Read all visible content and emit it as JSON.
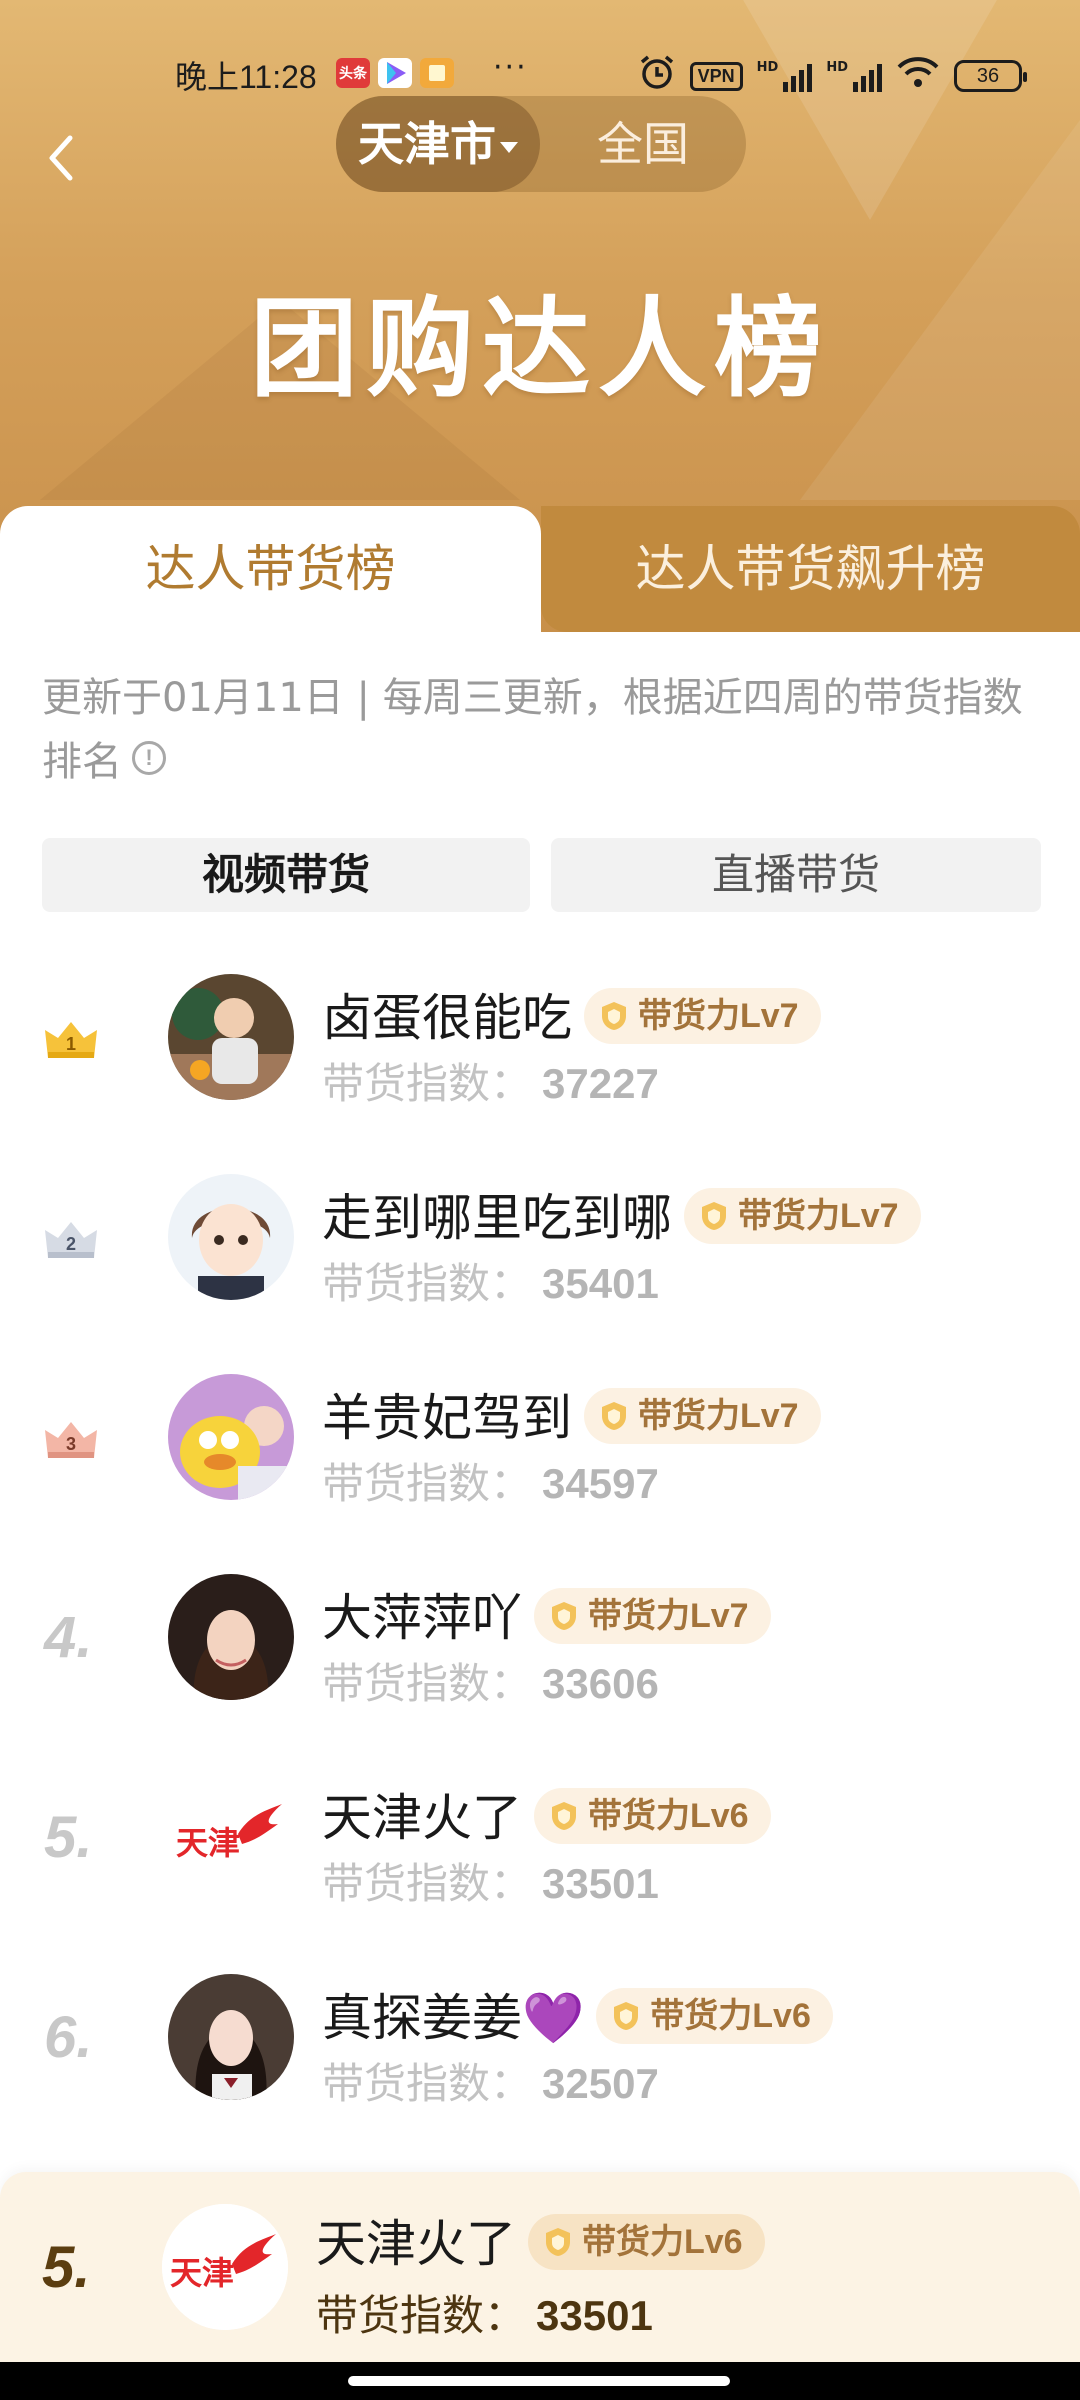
{
  "status_bar": {
    "time": "晚上11:28",
    "app_icons": [
      {
        "name": "toutiao-icon",
        "text": "头条",
        "color": "#e03a3a"
      },
      {
        "name": "video-app-icon",
        "text": "",
        "color": "#8a5cf6"
      },
      {
        "name": "reader-app-icon",
        "text": "",
        "color": "#f2a93b"
      }
    ],
    "more": "···",
    "vpn": "VPN",
    "hd1": "HD",
    "hd2": "HD",
    "battery": "36"
  },
  "nav": {
    "city_selected": "天津市",
    "city_other": "全国"
  },
  "title": "团购达人榜",
  "tabs": {
    "active": "达人带货榜",
    "inactive": "达人带货飙升榜"
  },
  "notice": "更新于01月11日 | 每周三更新，根据近四周的带货指数排名",
  "segments": {
    "video": "视频带货",
    "live": "直播带货"
  },
  "score_label": "带货指数：",
  "items": [
    {
      "rank": "1",
      "name": "卤蛋很能吃",
      "level": "带货力Lv7",
      "score": "37227"
    },
    {
      "rank": "2",
      "name": "走到哪里吃到哪",
      "level": "带货力Lv7",
      "score": "35401"
    },
    {
      "rank": "3",
      "name": "羊贵妃驾到",
      "level": "带货力Lv7",
      "score": "34597"
    },
    {
      "rank": "4.",
      "name": "大萍萍吖",
      "level": "带货力Lv7",
      "score": "33606"
    },
    {
      "rank": "5.",
      "name": "天津火了",
      "level": "带货力Lv6",
      "score": "33501",
      "avatar_text": "天津"
    },
    {
      "rank": "6.",
      "name": "真探姜姜💜",
      "level": "带货力Lv6",
      "score": "32507"
    }
  ],
  "mine": {
    "rank": "5.",
    "name": "天津火了",
    "level": "带货力Lv6",
    "score": "33501",
    "avatar_text": "天津"
  },
  "colors": {
    "brand_gold": "#c18a3e",
    "tab_active_text": "#b07b30",
    "badge_bg": "#fcf1e2"
  }
}
